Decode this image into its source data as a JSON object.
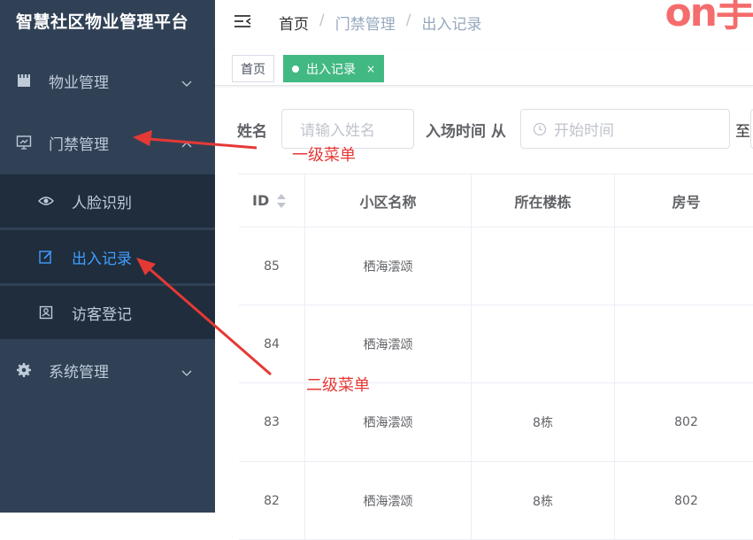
{
  "sidebar": {
    "brand": "智慧社区物业管理平台",
    "items": [
      {
        "label": "物业管理",
        "icon": "building-icon"
      },
      {
        "label": "门禁管理",
        "icon": "monitor-icon"
      },
      {
        "label": "人脸识别",
        "icon": "eye-icon"
      },
      {
        "label": "出入记录",
        "icon": "edit-icon"
      },
      {
        "label": "访客登记",
        "icon": "visitor-icon"
      },
      {
        "label": "系统管理",
        "icon": "gear-icon"
      }
    ]
  },
  "navbar": {
    "breadcrumb": [
      "首页",
      "门禁管理",
      "出入记录"
    ],
    "logo_text": "on手"
  },
  "tags": {
    "home": "首页",
    "current": "出入记录",
    "close": "×"
  },
  "filter": {
    "name_label": "姓名",
    "name_placeholder": "请输入姓名",
    "time_label": "入场时间 从",
    "start_placeholder": "开始时间",
    "to_label": "至"
  },
  "table": {
    "columns": [
      "ID",
      "小区名称",
      "所在楼栋",
      "房号"
    ],
    "rows": [
      {
        "id": "85",
        "community": "栖海澐颂",
        "building": "",
        "room": ""
      },
      {
        "id": "84",
        "community": "栖海澐颂",
        "building": "",
        "room": ""
      },
      {
        "id": "83",
        "community": "栖海澐颂",
        "building": "8栋",
        "room": "802"
      },
      {
        "id": "82",
        "community": "栖海澐颂",
        "building": "8栋",
        "room": "802"
      }
    ]
  },
  "annotations": {
    "level1": "一级菜单",
    "level2": "二级菜单"
  },
  "colors": {
    "sidebar_bg": "#304156",
    "submenu_bg": "#1f2d3d",
    "active_text": "#409eff",
    "tag_active": "#42b983",
    "annotation": "#e53935"
  }
}
